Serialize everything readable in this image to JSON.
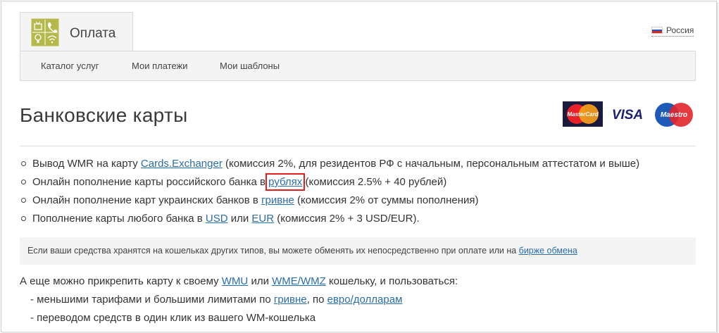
{
  "tab": {
    "title": "Оплата"
  },
  "nav": {
    "items": [
      "Каталог услуг",
      "Мои платежи",
      "Мои шаблоны"
    ]
  },
  "region": {
    "label": "Россия"
  },
  "page_title": "Банковские карты",
  "cards": {
    "mastercard": "MasterCard",
    "visa": "VISA",
    "maestro": "Maestro"
  },
  "bullets": {
    "b1": {
      "pre": "Вывод WMR на карту ",
      "link": "Cards.Exchanger",
      "post": " (комиссия 2%, для резидентов РФ с начальным, персональным аттестатом и выше)"
    },
    "b2": {
      "pre": "Онлайн пополнение карты российского банка в ",
      "link": "рублях",
      "post": " (комиссия 2.5% + 40 рублей)"
    },
    "b3": {
      "pre": "Онлайн пополнение карт украинских банков в ",
      "link": "гривне",
      "post": " (комиссия 2% от суммы пополнения)"
    },
    "b4": {
      "pre": "Пополнение карты любого банка в ",
      "link1": "USD",
      "mid": " или ",
      "link2": "EUR",
      "post": " (комиссия 2% + 3 USD/EUR)."
    }
  },
  "note": {
    "text": "Если ваши средства хранятся на кошельках других типов, вы можете обменять их непосредственно при оплате или на ",
    "link": "бирже обмена"
  },
  "attach": {
    "pre": "А еще можно прикрепить карту к своему ",
    "link1": "WMU",
    "mid": " или ",
    "link2": "WME/WMZ",
    "post": " кошельку, и пользоваться:"
  },
  "subs": {
    "s1": {
      "pre": "- меньшими тарифами и большими лимитами по ",
      "link1": "гривне",
      "mid": ", по ",
      "link2": "евро/долларам"
    },
    "s2": {
      "text": "- переводом средств в один клик из вашего WM-кошелька"
    }
  },
  "colors": {
    "link": "#2a6ea8",
    "highlight": "#e0201b",
    "panel": "#f4f4f4"
  }
}
